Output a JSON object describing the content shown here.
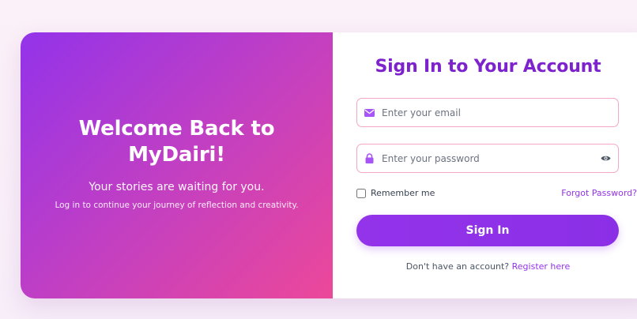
{
  "hero": {
    "title_line1": "Welcome Back to",
    "title_line2": "MyDairi!",
    "subtitle": "Your stories are waiting for you.",
    "description": "Log in to continue your journey of reflection and creativity."
  },
  "form": {
    "title": "Sign In to Your Account",
    "email": {
      "placeholder": "Enter your email",
      "value": "",
      "icon": "envelope-icon"
    },
    "password": {
      "placeholder": "Enter your password",
      "value": "",
      "icon": "lock-icon",
      "toggle_icon": "eye-icon"
    },
    "remember_label": "Remember me",
    "remember_checked": false,
    "forgot_label": "Forgot Password?",
    "submit_label": "Sign In",
    "register_prompt": "Don't have an account?",
    "register_link": "Register here"
  },
  "colors": {
    "accent": "#9333ea",
    "title": "#7e22ce",
    "field_border": "#f3a7c7",
    "gradient_start": "#9333ea",
    "gradient_end": "#ec4899"
  }
}
